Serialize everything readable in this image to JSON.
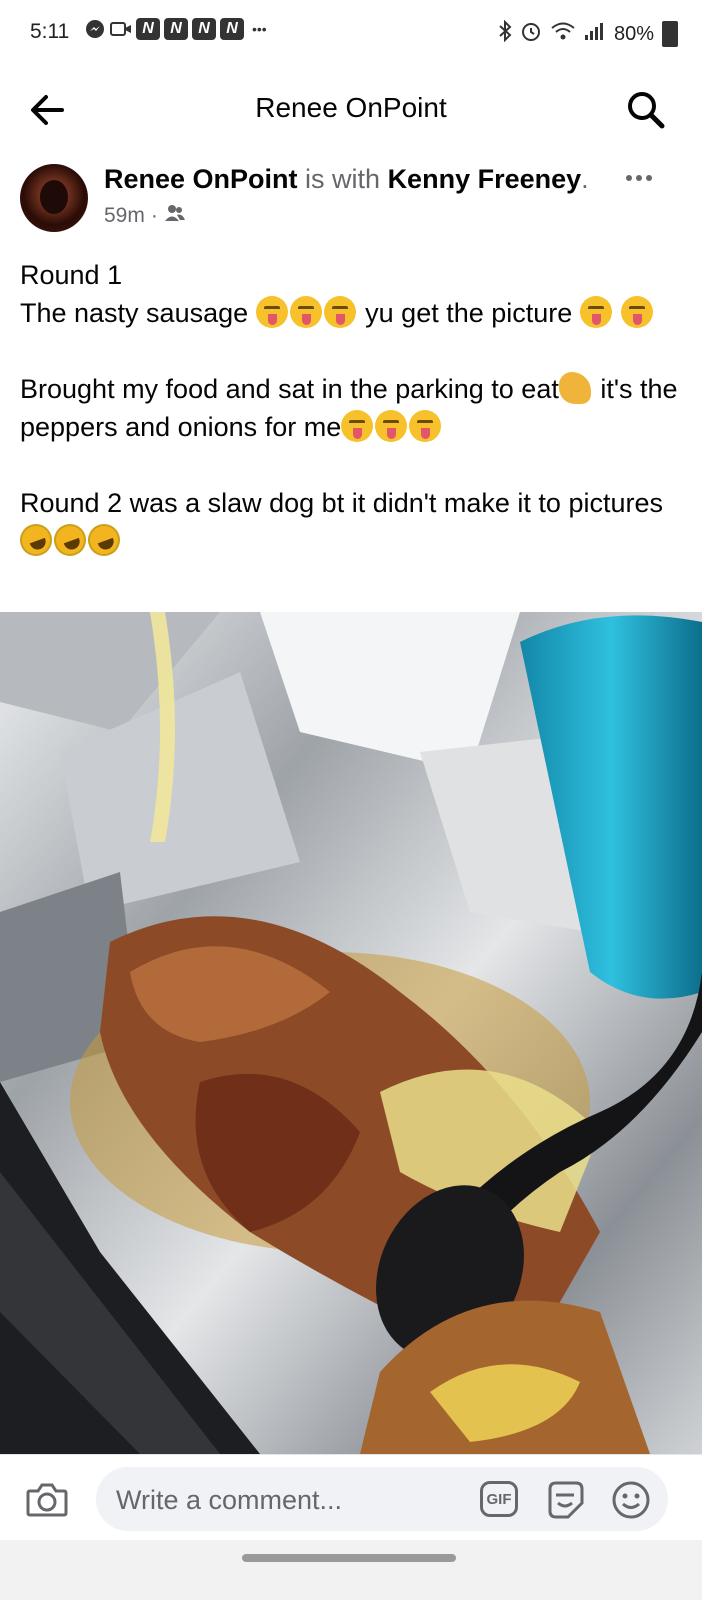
{
  "status_bar": {
    "time": "5:11",
    "battery": "80%"
  },
  "header": {
    "title": "Renee OnPoint"
  },
  "post": {
    "author": "Renee OnPoint",
    "with_text": " is with ",
    "tagged": "Kenny Freeney",
    "period": ".",
    "time": "59m",
    "separator": "·",
    "audience_icon": "friends-icon",
    "paragraphs": {
      "p1_line1": "Round 1",
      "p1_line2_a": "The nasty sausage ",
      "p1_line2_b": " yu get the picture ",
      "p2_a": "Brought my food and sat in the parking to eat",
      "p2_b": "it's the peppers and onions for me",
      "p3_a": "Round 2 was a slaw dog bt it didn't make it to pictures "
    }
  },
  "comment_bar": {
    "placeholder": "Write a comment...",
    "gif_label": "GIF"
  },
  "colors": {
    "text_primary": "#050505",
    "text_secondary": "#65676b",
    "input_bg": "#f0f2f5"
  }
}
